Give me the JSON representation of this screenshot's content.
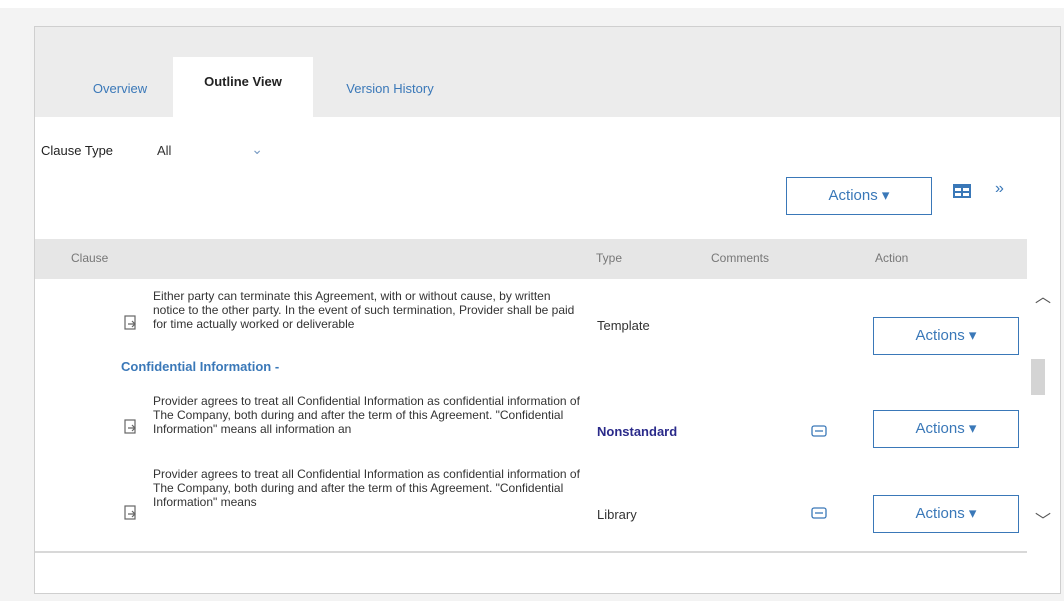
{
  "tabs": [
    {
      "label": "Overview"
    },
    {
      "label": "Outline View"
    },
    {
      "label": "Version History"
    }
  ],
  "filter": {
    "label": "Clause Type",
    "value": "All"
  },
  "toolbar": {
    "actions_label": "Actions ▾"
  },
  "table": {
    "columns": {
      "clause": "Clause",
      "type": "Type",
      "comments": "Comments",
      "action": "Action"
    },
    "rows": [
      {
        "text": "Either party can terminate this Agreement, with or without cause, by written notice to the other party. In the event of such termination, Provider shall be paid for time actually worked or deliverable",
        "type": "Template",
        "action_label": "Actions ▾"
      },
      {
        "text": "Provider agrees to treat all Confidential Information as confidential information of The Company, both during and after the term of this Agreement. \"Confidential Information\" means all information an",
        "type": "Nonstandard",
        "action_label": "Actions ▾"
      },
      {
        "text": "Provider agrees to treat all Confidential Information as confidential information of The Company, both during and after the term of this Agreement. \"Confidential Information\" means",
        "type": "Library",
        "action_label": "Actions ▾"
      }
    ],
    "section": "Confidential Information -"
  },
  "icons": {
    "document": "document-icon",
    "comment": "comment-icon",
    "grid": "grid-view-icon",
    "expand": "double-chevron-down-icon"
  },
  "colors": {
    "accent": "#3a78b8",
    "nonstandard": "#2a2a8a"
  }
}
